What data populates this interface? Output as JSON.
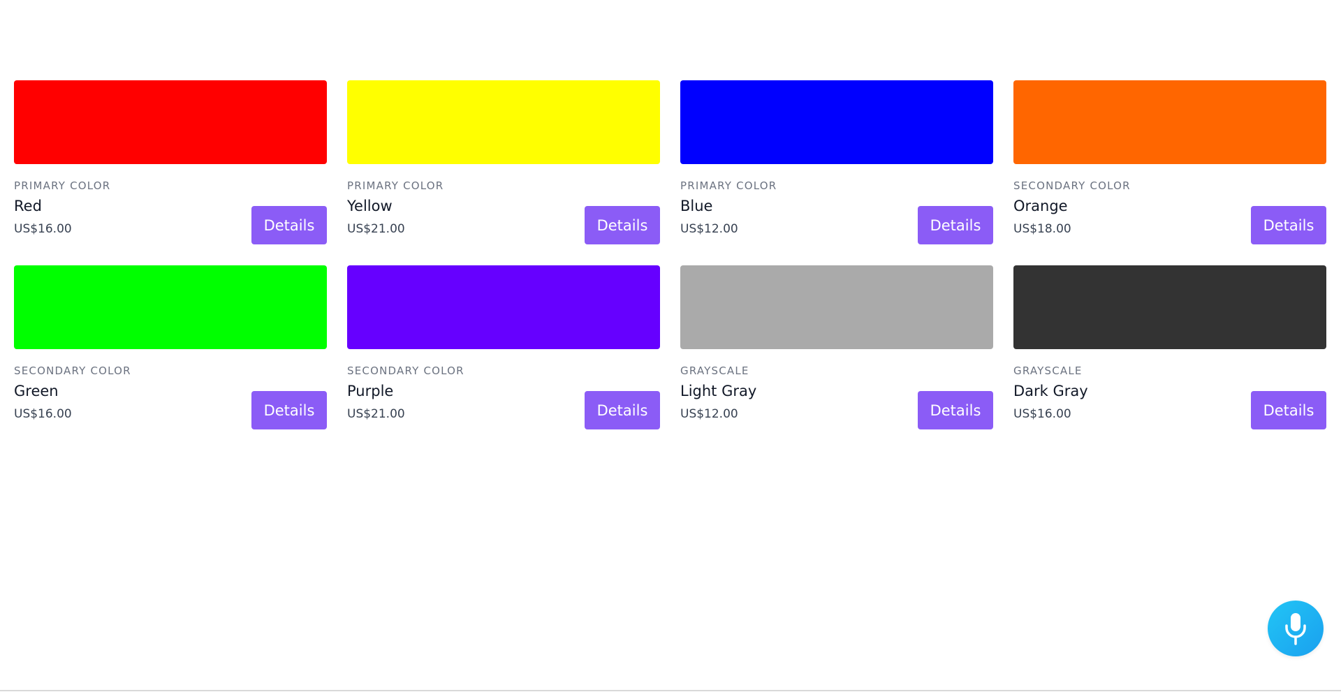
{
  "products": [
    {
      "category": "PRIMARY COLOR",
      "name": "Red",
      "price": "US$16.00",
      "color": "#ff0000",
      "button_label": "Details"
    },
    {
      "category": "PRIMARY COLOR",
      "name": "Yellow",
      "price": "US$21.00",
      "color": "#ffff00",
      "button_label": "Details"
    },
    {
      "category": "PRIMARY COLOR",
      "name": "Blue",
      "price": "US$12.00",
      "color": "#0000ff",
      "button_label": "Details"
    },
    {
      "category": "SECONDARY COLOR",
      "name": "Orange",
      "price": "US$18.00",
      "color": "#ff6600",
      "button_label": "Details"
    },
    {
      "category": "SECONDARY COLOR",
      "name": "Green",
      "price": "US$16.00",
      "color": "#00ff00",
      "button_label": "Details"
    },
    {
      "category": "SECONDARY COLOR",
      "name": "Purple",
      "price": "US$21.00",
      "color": "#6600ff",
      "button_label": "Details"
    },
    {
      "category": "GRAYSCALE",
      "name": "Light Gray",
      "price": "US$12.00",
      "color": "#aaaaaa",
      "button_label": "Details"
    },
    {
      "category": "GRAYSCALE",
      "name": "Dark Gray",
      "price": "US$16.00",
      "color": "#333333",
      "button_label": "Details"
    }
  ],
  "theme": {
    "button_color": "#8b5cf6",
    "mic_button_color": "#1fb6f3"
  },
  "mic_button": {
    "icon": "microphone-icon"
  }
}
